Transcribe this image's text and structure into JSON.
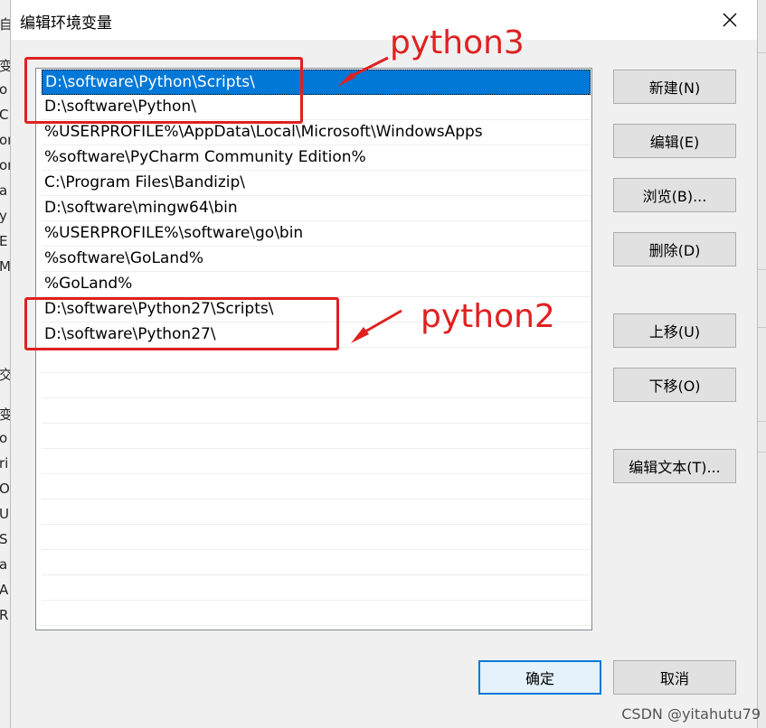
{
  "dialog": {
    "title": "编辑环境变量",
    "close_symbol": "✕"
  },
  "paths": [
    "D:\\software\\Python\\Scripts\\",
    "D:\\software\\Python\\",
    "%USERPROFILE%\\AppData\\Local\\Microsoft\\WindowsApps",
    "%software\\PyCharm Community Edition%",
    "C:\\Program Files\\Bandizip\\",
    "D:\\software\\mingw64\\bin",
    "%USERPROFILE%\\software\\go\\bin",
    "%software\\GoLand%",
    "%GoLand%",
    "D:\\software\\Python27\\Scripts\\",
    "D:\\software\\Python27\\"
  ],
  "selected_index": 0,
  "buttons": {
    "new": "新建(N)",
    "edit": "编辑(E)",
    "browse": "浏览(B)...",
    "delete": "删除(D)",
    "move_up": "上移(U)",
    "move_down": "下移(O)",
    "edit_text": "编辑文本(T)...",
    "ok": "确定",
    "cancel": "取消"
  },
  "annotations": {
    "python3": "python3",
    "python2": "python2",
    "color": "#e02020"
  },
  "background_fragments": [
    "自",
    "变",
    "o",
    "C",
    "on",
    "on",
    "a",
    "y",
    "E",
    "M",
    "交",
    "变",
    "o",
    "ri",
    "O",
    "U",
    "S",
    "a",
    "A",
    "R"
  ],
  "watermark": "CSDN @yitahutu79"
}
